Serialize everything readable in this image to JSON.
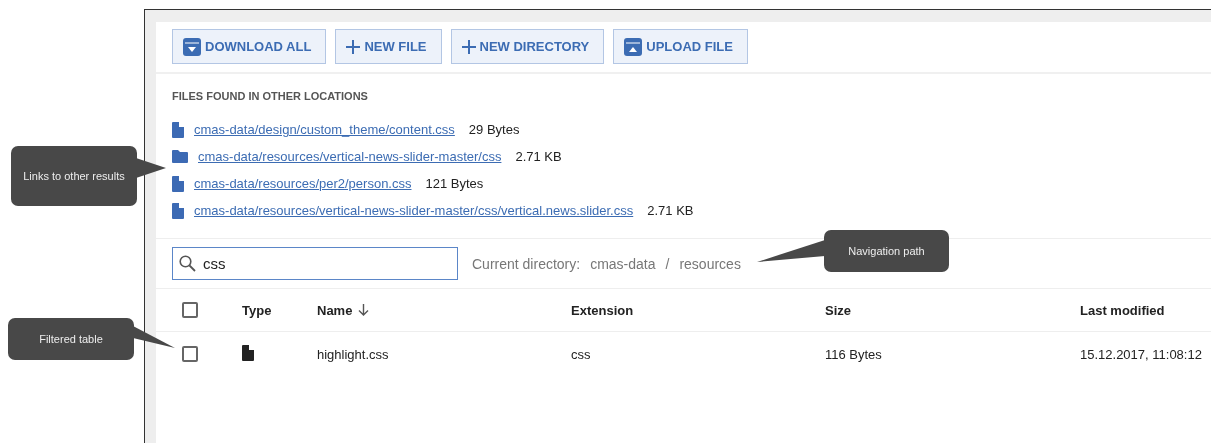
{
  "toolbar": {
    "buttons": [
      {
        "label": "DOWNLOAD ALL",
        "kind": "download"
      },
      {
        "label": "NEW FILE",
        "kind": "create"
      },
      {
        "label": "NEW DIRECTORY",
        "kind": "create"
      },
      {
        "label": "UPLOAD FILE",
        "kind": "upload"
      }
    ]
  },
  "other_locations": {
    "title": "FILES FOUND IN OTHER LOCATIONS",
    "items": [
      {
        "kind": "file",
        "path": "cmas-data/design/custom_theme/content.css",
        "size": "29 Bytes"
      },
      {
        "kind": "folder",
        "path": "cmas-data/resources/vertical-news-slider-master/css",
        "size": "2.71 KB"
      },
      {
        "kind": "file",
        "path": "cmas-data/resources/per2/person.css",
        "size": "121 Bytes"
      },
      {
        "kind": "file",
        "path": "cmas-data/resources/vertical-news-slider-master/css/vertical.news.slider.css",
        "size": "2.71 KB"
      }
    ]
  },
  "search": {
    "value": "css"
  },
  "breadcrumb": {
    "label": "Current directory:",
    "parts": [
      "cmas-data",
      "resources"
    ],
    "separator": "/"
  },
  "table": {
    "columns": [
      {
        "label": "Type"
      },
      {
        "label": "Name",
        "sorted": true
      },
      {
        "label": "Extension"
      },
      {
        "label": "Size"
      },
      {
        "label": "Last modified"
      }
    ],
    "header_checked": false,
    "rows": [
      {
        "checked": false,
        "kind": "file",
        "name": "highlight.css",
        "extension": "css",
        "size": "116 Bytes",
        "modified": "15.12.2017, 11:08:12"
      }
    ]
  },
  "annotations": [
    {
      "text": "Links to other results"
    },
    {
      "text": "Filtered table"
    },
    {
      "text": "Navigation path"
    }
  ]
}
